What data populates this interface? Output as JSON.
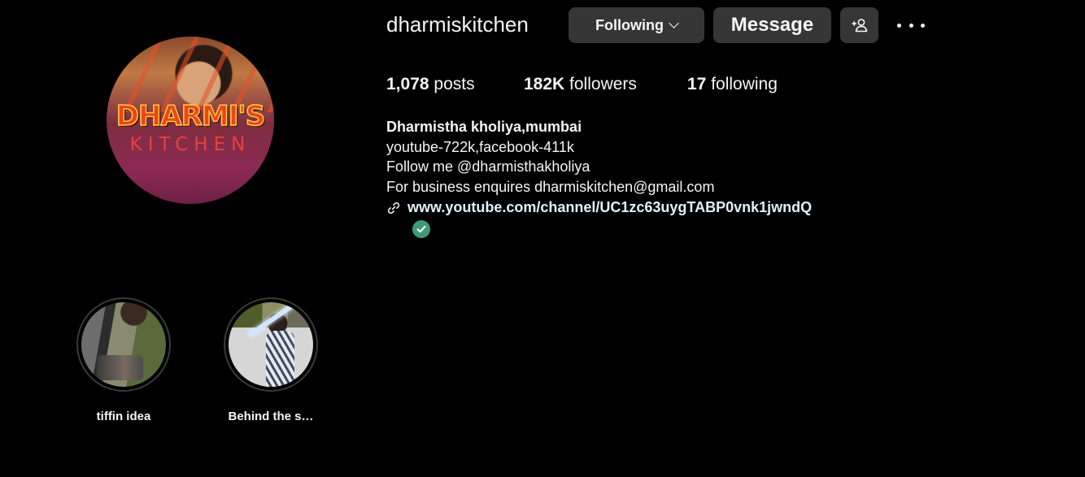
{
  "profile": {
    "username": "dharmiskitchen",
    "avatar_logo_line1": "DHARMI'S",
    "avatar_logo_line2": "KITCHEN"
  },
  "actions": {
    "following_label": "Following",
    "message_label": "Message",
    "add_user_icon": "add-user-icon",
    "more_icon": "more-options-icon"
  },
  "stats": {
    "posts_count": "1,078",
    "posts_label": "posts",
    "followers_count": "182K",
    "followers_label": "followers",
    "following_count": "17",
    "following_label": "following"
  },
  "bio": {
    "name": "Dharmistha kholiya,mumbai",
    "line1": "youtube-722k,facebook-411k",
    "line2": "Follow me @dharmisthakholiya",
    "line3": "For business enquires dharmiskitchen@gmail.com",
    "link": "www.youtube.com/channel/UC1zc63uygTABP0vnk1jwndQ",
    "link_icon": "link-icon",
    "verified_icon": "verified-check-icon"
  },
  "highlights": [
    {
      "label": "tiffin idea"
    },
    {
      "label": "Behind the s…"
    }
  ],
  "colors": {
    "background": "#000000",
    "button_bg": "#363636",
    "link": "#e0f1ff",
    "verified": "#3f9a7a"
  }
}
